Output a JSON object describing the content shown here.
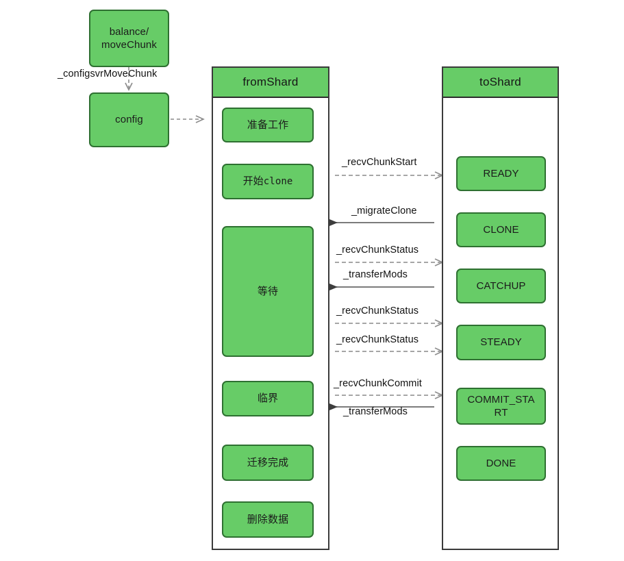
{
  "diagram": {
    "title": "MongoDB chunk migration sequence (balancer moveChunk)",
    "colors": {
      "node_fill": "#67CC67",
      "node_border": "#2E7031",
      "lane_border": "#3a3a3a",
      "lane_title_fill": "#67CC67",
      "arrow_solid": "#4d4d4d",
      "arrow_dashed": "#9a9a9a",
      "text": "#111111"
    }
  },
  "left_flow": {
    "balancer_label": "balance/\nmoveChunk",
    "balancer_line1": "balance/",
    "balancer_line2": "moveChunk",
    "config_label": "config",
    "edge_balancer_to_config": "_configsvrMoveChunk"
  },
  "lanes": [
    {
      "id": "fromShard",
      "title": "fromShard",
      "steps": [
        {
          "id": "prepare",
          "label": "准备工作"
        },
        {
          "id": "start-clone",
          "label": "开始clone",
          "label_plain": "开始",
          "label_mono": "clone"
        },
        {
          "id": "waiting",
          "label": "等待"
        },
        {
          "id": "critical",
          "label": "临界"
        },
        {
          "id": "migrate-done",
          "label": "迁移完成"
        },
        {
          "id": "delete-data",
          "label": "删除数据"
        }
      ]
    },
    {
      "id": "toShard",
      "title": "toShard",
      "steps": [
        {
          "id": "ready",
          "label": "READY"
        },
        {
          "id": "clone",
          "label": "CLONE"
        },
        {
          "id": "catchup",
          "label": "CATCHUP"
        },
        {
          "id": "steady",
          "label": "STEADY"
        },
        {
          "id": "commit-start",
          "label": "COMMIT_STA\nRT",
          "label_line1": "COMMIT_STA",
          "label_line2": "RT"
        },
        {
          "id": "done",
          "label": "DONE"
        }
      ]
    }
  ],
  "messages": [
    {
      "id": "recv-chunk-start",
      "label": "_recvChunkStart",
      "direction": "to-right",
      "style": "dashed"
    },
    {
      "id": "migrate-clone",
      "label": "_migrateClone",
      "direction": "to-left",
      "style": "solid"
    },
    {
      "id": "recv-chunk-status-1",
      "label": "_recvChunkStatus",
      "direction": "to-right",
      "style": "dashed"
    },
    {
      "id": "transfer-mods-1",
      "label": "_transferMods",
      "direction": "to-left",
      "style": "solid"
    },
    {
      "id": "recv-chunk-status-2",
      "label": "_recvChunkStatus",
      "direction": "to-right",
      "style": "dashed"
    },
    {
      "id": "recv-chunk-status-3",
      "label": "_recvChunkStatus",
      "direction": "to-right",
      "style": "dashed"
    },
    {
      "id": "recv-chunk-commit",
      "label": "_recvChunkCommit",
      "direction": "to-right",
      "style": "dashed"
    },
    {
      "id": "transfer-mods-2",
      "label": "_transferMods",
      "direction": "to-left",
      "style": "solid"
    }
  ],
  "edge_config_to_fromshard": ""
}
